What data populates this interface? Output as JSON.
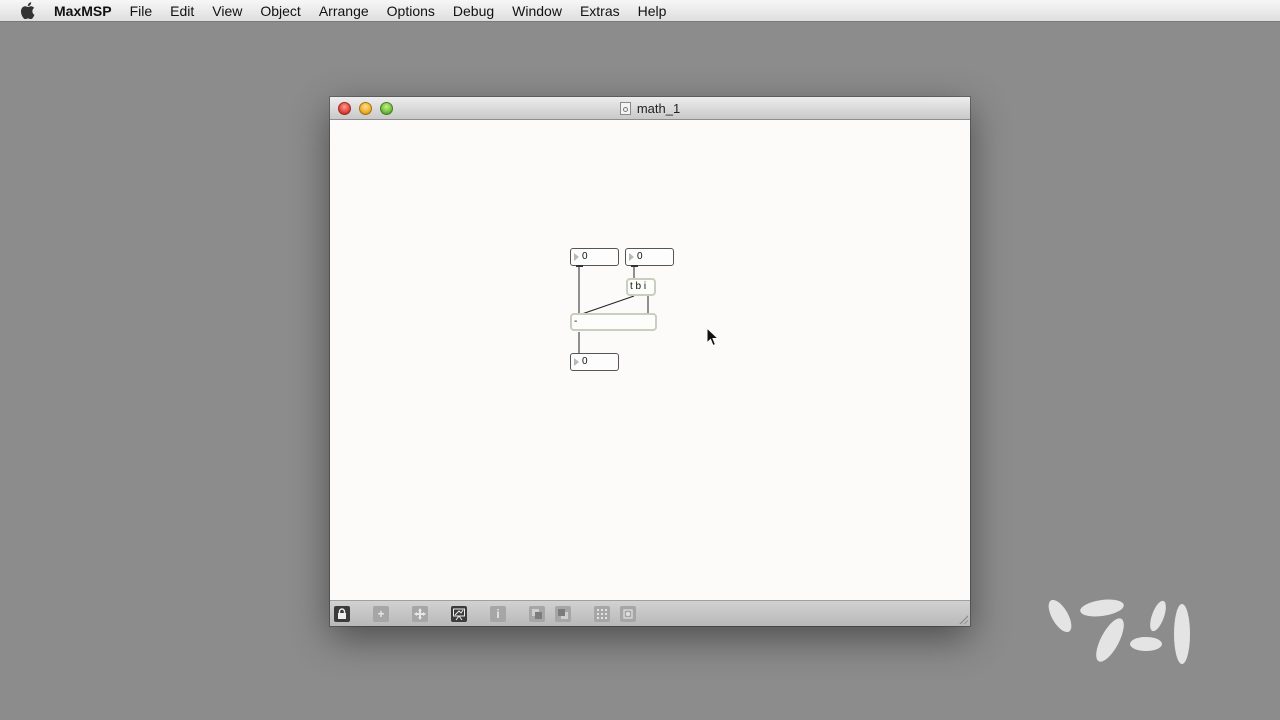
{
  "menubar": {
    "app_name": "MaxMSP",
    "items": [
      "File",
      "Edit",
      "View",
      "Object",
      "Arrange",
      "Options",
      "Debug",
      "Window",
      "Extras",
      "Help"
    ]
  },
  "window": {
    "title": "math_1"
  },
  "patch": {
    "number_box_left": "0",
    "number_box_right": "0",
    "trigger_object": "t b i",
    "minus_object": "-",
    "number_box_result": "0"
  },
  "toolbar": {
    "buttons": [
      "lock-icon",
      "plus-icon",
      "move-icon",
      "presentation-icon",
      "info-icon",
      "front-icon",
      "back-icon",
      "grid-icon",
      "snap-icon"
    ],
    "info_label": "i",
    "plus_label": "+"
  },
  "icons": [
    "apple-icon",
    "document-icon",
    "mouse-cursor-icon",
    "logo-icon"
  ],
  "colors": {
    "desktop": "#8c8c8c",
    "canvas": "#fdfbf9",
    "object_border": "#c9cfbe",
    "close": "#e0443b",
    "minimize": "#efad2b",
    "maximize": "#6fbf3a"
  }
}
